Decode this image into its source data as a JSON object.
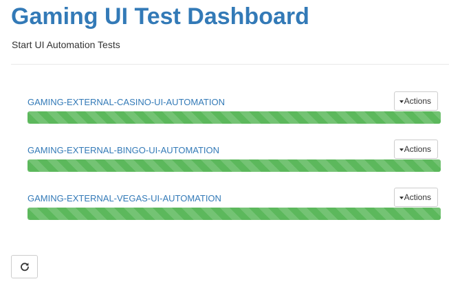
{
  "header": {
    "title": "Gaming UI Test Dashboard",
    "subtitle": "Start UI Automation Tests"
  },
  "jobs": [
    {
      "name": "GAMING-EXTERNAL-CASINO-UI-AUTOMATION",
      "actions_label": "Actions",
      "progress": 1.0
    },
    {
      "name": "GAMING-EXTERNAL-BINGO-UI-AUTOMATION",
      "actions_label": "Actions",
      "progress": 1.0
    },
    {
      "name": "GAMING-EXTERNAL-VEGAS-UI-AUTOMATION",
      "actions_label": "Actions",
      "progress": 1.0
    }
  ],
  "colors": {
    "title": "#337ab7",
    "link": "#337ab7",
    "progress_success": "#5cb85c"
  },
  "icons": {
    "refresh": "refresh-icon",
    "actions_caret": "caret-down-icon"
  }
}
